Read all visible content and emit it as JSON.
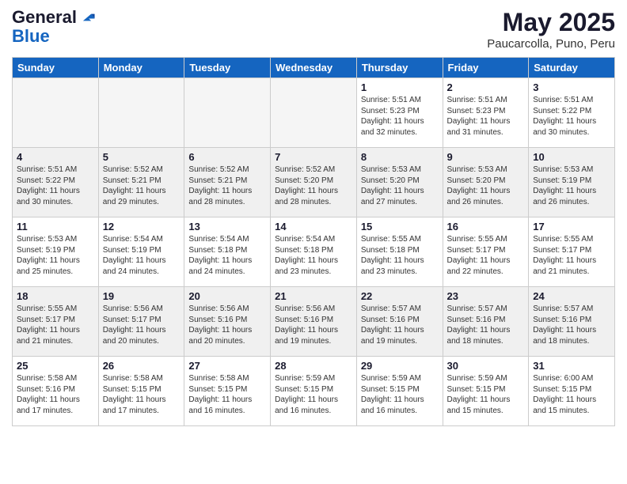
{
  "header": {
    "logo_general": "General",
    "logo_blue": "Blue",
    "month_year": "May 2025",
    "location": "Paucarcolla, Puno, Peru"
  },
  "weekdays": [
    "Sunday",
    "Monday",
    "Tuesday",
    "Wednesday",
    "Thursday",
    "Friday",
    "Saturday"
  ],
  "weeks": [
    [
      {
        "day": "",
        "info": ""
      },
      {
        "day": "",
        "info": ""
      },
      {
        "day": "",
        "info": ""
      },
      {
        "day": "",
        "info": ""
      },
      {
        "day": "1",
        "info": "Sunrise: 5:51 AM\nSunset: 5:23 PM\nDaylight: 11 hours\nand 32 minutes."
      },
      {
        "day": "2",
        "info": "Sunrise: 5:51 AM\nSunset: 5:23 PM\nDaylight: 11 hours\nand 31 minutes."
      },
      {
        "day": "3",
        "info": "Sunrise: 5:51 AM\nSunset: 5:22 PM\nDaylight: 11 hours\nand 30 minutes."
      }
    ],
    [
      {
        "day": "4",
        "info": "Sunrise: 5:51 AM\nSunset: 5:22 PM\nDaylight: 11 hours\nand 30 minutes."
      },
      {
        "day": "5",
        "info": "Sunrise: 5:52 AM\nSunset: 5:21 PM\nDaylight: 11 hours\nand 29 minutes."
      },
      {
        "day": "6",
        "info": "Sunrise: 5:52 AM\nSunset: 5:21 PM\nDaylight: 11 hours\nand 28 minutes."
      },
      {
        "day": "7",
        "info": "Sunrise: 5:52 AM\nSunset: 5:20 PM\nDaylight: 11 hours\nand 28 minutes."
      },
      {
        "day": "8",
        "info": "Sunrise: 5:53 AM\nSunset: 5:20 PM\nDaylight: 11 hours\nand 27 minutes."
      },
      {
        "day": "9",
        "info": "Sunrise: 5:53 AM\nSunset: 5:20 PM\nDaylight: 11 hours\nand 26 minutes."
      },
      {
        "day": "10",
        "info": "Sunrise: 5:53 AM\nSunset: 5:19 PM\nDaylight: 11 hours\nand 26 minutes."
      }
    ],
    [
      {
        "day": "11",
        "info": "Sunrise: 5:53 AM\nSunset: 5:19 PM\nDaylight: 11 hours\nand 25 minutes."
      },
      {
        "day": "12",
        "info": "Sunrise: 5:54 AM\nSunset: 5:19 PM\nDaylight: 11 hours\nand 24 minutes."
      },
      {
        "day": "13",
        "info": "Sunrise: 5:54 AM\nSunset: 5:18 PM\nDaylight: 11 hours\nand 24 minutes."
      },
      {
        "day": "14",
        "info": "Sunrise: 5:54 AM\nSunset: 5:18 PM\nDaylight: 11 hours\nand 23 minutes."
      },
      {
        "day": "15",
        "info": "Sunrise: 5:55 AM\nSunset: 5:18 PM\nDaylight: 11 hours\nand 23 minutes."
      },
      {
        "day": "16",
        "info": "Sunrise: 5:55 AM\nSunset: 5:17 PM\nDaylight: 11 hours\nand 22 minutes."
      },
      {
        "day": "17",
        "info": "Sunrise: 5:55 AM\nSunset: 5:17 PM\nDaylight: 11 hours\nand 21 minutes."
      }
    ],
    [
      {
        "day": "18",
        "info": "Sunrise: 5:55 AM\nSunset: 5:17 PM\nDaylight: 11 hours\nand 21 minutes."
      },
      {
        "day": "19",
        "info": "Sunrise: 5:56 AM\nSunset: 5:17 PM\nDaylight: 11 hours\nand 20 minutes."
      },
      {
        "day": "20",
        "info": "Sunrise: 5:56 AM\nSunset: 5:16 PM\nDaylight: 11 hours\nand 20 minutes."
      },
      {
        "day": "21",
        "info": "Sunrise: 5:56 AM\nSunset: 5:16 PM\nDaylight: 11 hours\nand 19 minutes."
      },
      {
        "day": "22",
        "info": "Sunrise: 5:57 AM\nSunset: 5:16 PM\nDaylight: 11 hours\nand 19 minutes."
      },
      {
        "day": "23",
        "info": "Sunrise: 5:57 AM\nSunset: 5:16 PM\nDaylight: 11 hours\nand 18 minutes."
      },
      {
        "day": "24",
        "info": "Sunrise: 5:57 AM\nSunset: 5:16 PM\nDaylight: 11 hours\nand 18 minutes."
      }
    ],
    [
      {
        "day": "25",
        "info": "Sunrise: 5:58 AM\nSunset: 5:16 PM\nDaylight: 11 hours\nand 17 minutes."
      },
      {
        "day": "26",
        "info": "Sunrise: 5:58 AM\nSunset: 5:15 PM\nDaylight: 11 hours\nand 17 minutes."
      },
      {
        "day": "27",
        "info": "Sunrise: 5:58 AM\nSunset: 5:15 PM\nDaylight: 11 hours\nand 16 minutes."
      },
      {
        "day": "28",
        "info": "Sunrise: 5:59 AM\nSunset: 5:15 PM\nDaylight: 11 hours\nand 16 minutes."
      },
      {
        "day": "29",
        "info": "Sunrise: 5:59 AM\nSunset: 5:15 PM\nDaylight: 11 hours\nand 16 minutes."
      },
      {
        "day": "30",
        "info": "Sunrise: 5:59 AM\nSunset: 5:15 PM\nDaylight: 11 hours\nand 15 minutes."
      },
      {
        "day": "31",
        "info": "Sunrise: 6:00 AM\nSunset: 5:15 PM\nDaylight: 11 hours\nand 15 minutes."
      }
    ]
  ]
}
